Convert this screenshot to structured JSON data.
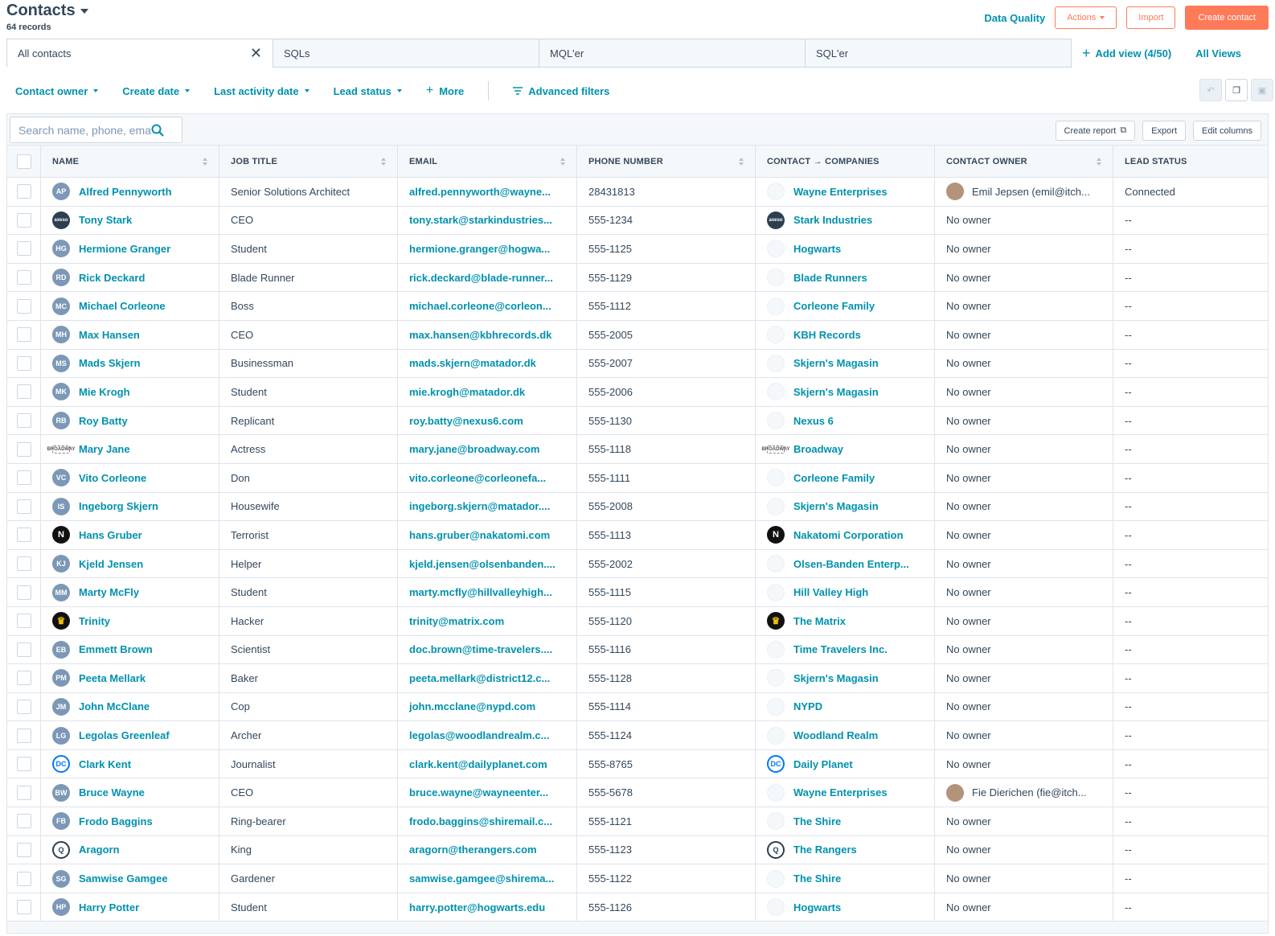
{
  "header": {
    "title": "Contacts",
    "record_count": "64 records"
  },
  "top_actions": {
    "data_quality": "Data Quality",
    "actions": "Actions",
    "import": "Import",
    "create_contact": "Create contact"
  },
  "views": {
    "tabs": [
      "All contacts",
      "SQLs",
      "MQL'er",
      "SQL'er"
    ],
    "add_view": "Add view (4/50)",
    "all_views": "All Views"
  },
  "filters": {
    "items": [
      "Contact owner",
      "Create date",
      "Last activity date",
      "Lead status"
    ],
    "more": "More",
    "advanced": "Advanced filters"
  },
  "toolbar": {
    "search_placeholder": "Search name, phone, email",
    "create_report": "Create report",
    "export": "Export",
    "edit_columns": "Edit columns"
  },
  "table": {
    "columns": [
      "NAME",
      "JOB TITLE",
      "EMAIL",
      "PHONE NUMBER",
      "CONTACT → COMPANIES",
      "CONTACT OWNER",
      "LEAD STATUS"
    ],
    "rows": [
      {
        "initials": "AP",
        "avatar": "initials",
        "name": "Alfred Pennyworth",
        "job": "Senior Solutions Architect",
        "email": "alfred.pennyworth@wayne...",
        "phone": "28431813",
        "company": "Wayne Enterprises",
        "company_logo": "default",
        "owner": "Emil Jepsen (emil@itch...",
        "owner_photo": true,
        "status": "Connected"
      },
      {
        "initials": "axeso",
        "avatar": "dark",
        "name": "Tony Stark",
        "job": "CEO",
        "email": "tony.stark@starkindustries...",
        "phone": "555-1234",
        "company": "Stark Industries",
        "company_logo": "dark",
        "owner": "No owner",
        "owner_photo": false,
        "status": "--"
      },
      {
        "initials": "HG",
        "avatar": "initials",
        "name": "Hermione Granger",
        "job": "Student",
        "email": "hermione.granger@hogwa...",
        "phone": "555-1125",
        "company": "Hogwarts",
        "company_logo": "default",
        "owner": "No owner",
        "owner_photo": false,
        "status": "--"
      },
      {
        "initials": "RD",
        "avatar": "initials",
        "name": "Rick Deckard",
        "job": "Blade Runner",
        "email": "rick.deckard@blade-runner...",
        "phone": "555-1129",
        "company": "Blade Runners",
        "company_logo": "default",
        "owner": "No owner",
        "owner_photo": false,
        "status": "--"
      },
      {
        "initials": "MC",
        "avatar": "initials",
        "name": "Michael Corleone",
        "job": "Boss",
        "email": "michael.corleone@corleon...",
        "phone": "555-1112",
        "company": "Corleone Family",
        "company_logo": "default",
        "owner": "No owner",
        "owner_photo": false,
        "status": "--"
      },
      {
        "initials": "MH",
        "avatar": "initials",
        "name": "Max Hansen",
        "job": "CEO",
        "email": "max.hansen@kbhrecords.dk",
        "phone": "555-2005",
        "company": "KBH Records",
        "company_logo": "default",
        "owner": "No owner",
        "owner_photo": false,
        "status": "--"
      },
      {
        "initials": "MS",
        "avatar": "initials",
        "name": "Mads Skjern",
        "job": "Businessman",
        "email": "mads.skjern@matador.dk",
        "phone": "555-2007",
        "company": "Skjern's Magasin",
        "company_logo": "default",
        "owner": "No owner",
        "owner_photo": false,
        "status": "--"
      },
      {
        "initials": "MK",
        "avatar": "initials",
        "name": "Mie Krogh",
        "job": "Student",
        "email": "mie.krogh@matador.dk",
        "phone": "555-2006",
        "company": "Skjern's Magasin",
        "company_logo": "default",
        "owner": "No owner",
        "owner_photo": false,
        "status": "--"
      },
      {
        "initials": "RB",
        "avatar": "initials",
        "name": "Roy Batty",
        "job": "Replicant",
        "email": "roy.batty@nexus6.com",
        "phone": "555-1130",
        "company": "Nexus 6",
        "company_logo": "default",
        "owner": "No owner",
        "owner_photo": false,
        "status": "--"
      },
      {
        "initials": "BROADWAY",
        "avatar": "wide",
        "name": "Mary Jane",
        "job": "Actress",
        "email": "mary.jane@broadway.com",
        "phone": "555-1118",
        "company": "Broadway",
        "company_logo": "wide",
        "owner": "No owner",
        "owner_photo": false,
        "status": "--"
      },
      {
        "initials": "VC",
        "avatar": "initials",
        "name": "Vito Corleone",
        "job": "Don",
        "email": "vito.corleone@corleonefa...",
        "phone": "555-1111",
        "company": "Corleone Family",
        "company_logo": "default",
        "owner": "No owner",
        "owner_photo": false,
        "status": "--"
      },
      {
        "initials": "IS",
        "avatar": "initials",
        "name": "Ingeborg Skjern",
        "job": "Housewife",
        "email": "ingeborg.skjern@matador....",
        "phone": "555-2008",
        "company": "Skjern's Magasin",
        "company_logo": "default",
        "owner": "No owner",
        "owner_photo": false,
        "status": "--"
      },
      {
        "initials": "N",
        "avatar": "black",
        "name": "Hans Gruber",
        "job": "Terrorist",
        "email": "hans.gruber@nakatomi.com",
        "phone": "555-1113",
        "company": "Nakatomi Corporation",
        "company_logo": "black",
        "owner": "No owner",
        "owner_photo": false,
        "status": "--"
      },
      {
        "initials": "KJ",
        "avatar": "initials",
        "name": "Kjeld Jensen",
        "job": "Helper",
        "email": "kjeld.jensen@olsenbanden....",
        "phone": "555-2002",
        "company": "Olsen-Banden Enterp...",
        "company_logo": "default",
        "owner": "No owner",
        "owner_photo": false,
        "status": "--"
      },
      {
        "initials": "MM",
        "avatar": "initials",
        "name": "Marty McFly",
        "job": "Student",
        "email": "marty.mcfly@hillvalleyhigh...",
        "phone": "555-1115",
        "company": "Hill Valley High",
        "company_logo": "default",
        "owner": "No owner",
        "owner_photo": false,
        "status": "--"
      },
      {
        "initials": "♛",
        "avatar": "matrix",
        "name": "Trinity",
        "job": "Hacker",
        "email": "trinity@matrix.com",
        "phone": "555-1120",
        "company": "The Matrix",
        "company_logo": "matrix",
        "owner": "No owner",
        "owner_photo": false,
        "status": "--"
      },
      {
        "initials": "EB",
        "avatar": "initials",
        "name": "Emmett Brown",
        "job": "Scientist",
        "email": "doc.brown@time-travelers....",
        "phone": "555-1116",
        "company": "Time Travelers Inc.",
        "company_logo": "default",
        "owner": "No owner",
        "owner_photo": false,
        "status": "--"
      },
      {
        "initials": "PM",
        "avatar": "initials",
        "name": "Peeta Mellark",
        "job": "Baker",
        "email": "peeta.mellark@district12.c...",
        "phone": "555-1128",
        "company": "Skjern's Magasin",
        "company_logo": "default",
        "owner": "No owner",
        "owner_photo": false,
        "status": "--"
      },
      {
        "initials": "JM",
        "avatar": "initials",
        "name": "John McClane",
        "job": "Cop",
        "email": "john.mcclane@nypd.com",
        "phone": "555-1114",
        "company": "NYPD",
        "company_logo": "default",
        "owner": "No owner",
        "owner_photo": false,
        "status": "--"
      },
      {
        "initials": "LG",
        "avatar": "initials",
        "name": "Legolas Greenleaf",
        "job": "Archer",
        "email": "legolas@woodlandrealm.c...",
        "phone": "555-1124",
        "company": "Woodland Realm",
        "company_logo": "default",
        "owner": "No owner",
        "owner_photo": false,
        "status": "--"
      },
      {
        "initials": "DC",
        "avatar": "dc",
        "name": "Clark Kent",
        "job": "Journalist",
        "email": "clark.kent@dailyplanet.com",
        "phone": "555-8765",
        "company": "Daily Planet",
        "company_logo": "dc",
        "owner": "No owner",
        "owner_photo": false,
        "status": "--"
      },
      {
        "initials": "BW",
        "avatar": "initials",
        "name": "Bruce Wayne",
        "job": "CEO",
        "email": "bruce.wayne@wayneenter...",
        "phone": "555-5678",
        "company": "Wayne Enterprises",
        "company_logo": "default",
        "owner": "Fie Dierichen (fie@itch...",
        "owner_photo": true,
        "status": "--"
      },
      {
        "initials": "FB",
        "avatar": "initials",
        "name": "Frodo Baggins",
        "job": "Ring-bearer",
        "email": "frodo.baggins@shiremail.c...",
        "phone": "555-1121",
        "company": "The Shire",
        "company_logo": "default",
        "owner": "No owner",
        "owner_photo": false,
        "status": "--"
      },
      {
        "initials": "Q",
        "avatar": "ring",
        "name": "Aragorn",
        "job": "King",
        "email": "aragorn@therangers.com",
        "phone": "555-1123",
        "company": "The Rangers",
        "company_logo": "ring",
        "owner": "No owner",
        "owner_photo": false,
        "status": "--"
      },
      {
        "initials": "SG",
        "avatar": "initials",
        "name": "Samwise Gamgee",
        "job": "Gardener",
        "email": "samwise.gamgee@shirema...",
        "phone": "555-1122",
        "company": "The Shire",
        "company_logo": "default",
        "owner": "No owner",
        "owner_photo": false,
        "status": "--"
      },
      {
        "initials": "HP",
        "avatar": "initials",
        "name": "Harry Potter",
        "job": "Student",
        "email": "harry.potter@hogwarts.edu",
        "phone": "555-1126",
        "company": "Hogwarts",
        "company_logo": "default",
        "owner": "No owner",
        "owner_photo": false,
        "status": "--"
      }
    ]
  },
  "colors": {
    "accent": "#0091ae",
    "brand_orange": "#ff7a59",
    "text": "#33475b",
    "border": "#dfe3eb"
  }
}
